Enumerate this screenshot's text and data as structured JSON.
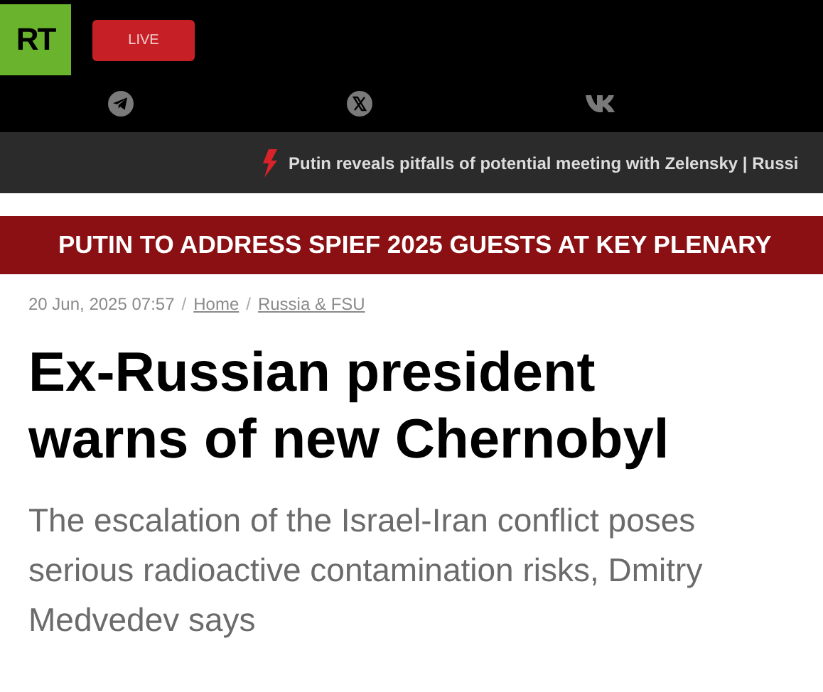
{
  "header": {
    "logo": "RT",
    "live_button": "LIVE",
    "social_links": [
      {
        "kind": "telegram"
      },
      {
        "kind": "x"
      },
      {
        "kind": "vk"
      }
    ]
  },
  "ticker": {
    "text": "Putin reveals pitfalls of potential meeting with Zelensky | Russi"
  },
  "banner": {
    "text": "PUTIN TO ADDRESS SPIEF 2025 GUESTS AT KEY PLENARY"
  },
  "article": {
    "date": "20 Jun, 2025 07:57",
    "breadcrumbs": [
      {
        "separator": "/",
        "label": "Home"
      },
      {
        "separator": "/",
        "label": "Russia & FSU"
      }
    ],
    "headline": "Ex-Russian president warns of new Chernobyl",
    "summary": "The escalation of the Israel-Iran conflict poses serious radioactive contamination risks, Dmitry Medvedev says"
  }
}
